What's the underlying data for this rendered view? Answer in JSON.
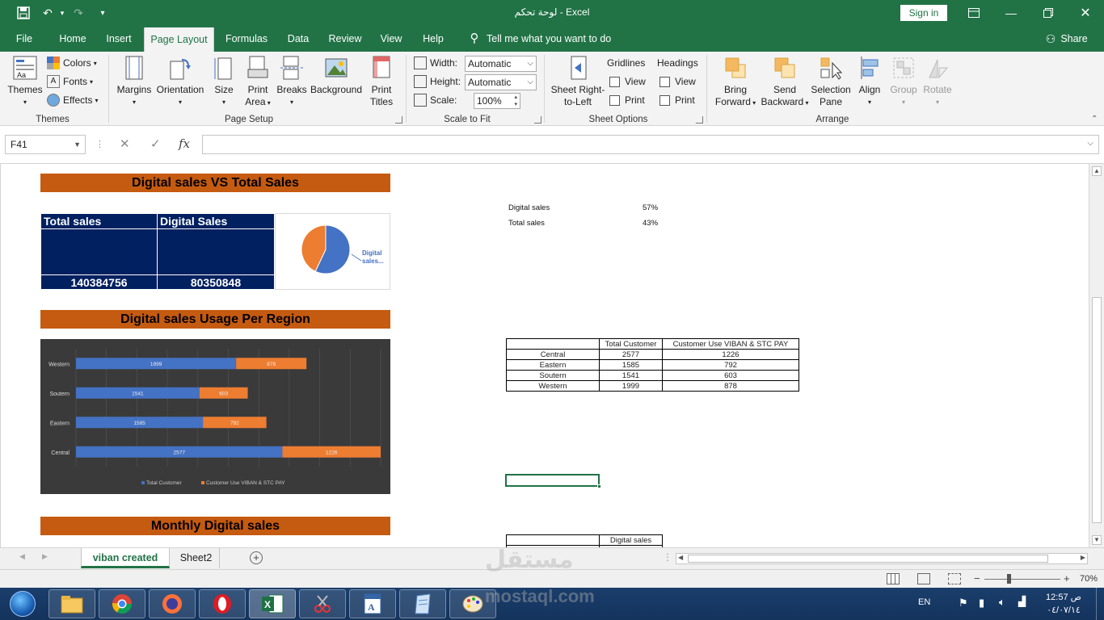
{
  "window": {
    "title": "لوحة تحكم  -  Excel",
    "sign_in": "Sign in",
    "share": "Share"
  },
  "tabs": [
    "File",
    "Home",
    "Insert",
    "Page Layout",
    "Formulas",
    "Data",
    "Review",
    "View",
    "Help"
  ],
  "active_tab": "Page Layout",
  "tell_me": "Tell me what you want to do",
  "ribbon": {
    "themes": {
      "themes_label": "Themes",
      "colors": "Colors",
      "fonts": "Fonts",
      "effects": "Effects",
      "group": "Themes"
    },
    "page_setup": {
      "margins": "Margins",
      "orientation": "Orientation",
      "size": "Size",
      "print_area_1": "Print",
      "print_area_2": "Area",
      "breaks": "Breaks",
      "background": "Background",
      "print_titles_1": "Print",
      "print_titles_2": "Titles",
      "group": "Page Setup"
    },
    "scale_to_fit": {
      "width_label": "Width:",
      "width_value": "Automatic",
      "height_label": "Height:",
      "height_value": "Automatic",
      "scale_label": "Scale:",
      "scale_value": "100%",
      "group": "Scale to Fit"
    },
    "sheet_options": {
      "sheet_rtl_1": "Sheet Right-",
      "sheet_rtl_2": "to-Left",
      "gridlines": "Gridlines",
      "headings": "Headings",
      "view": "View",
      "print": "Print",
      "group": "Sheet Options"
    },
    "arrange": {
      "bring_1": "Bring",
      "bring_2": "Forward",
      "send_1": "Send",
      "send_2": "Backward",
      "selection_1": "Selection",
      "selection_2": "Pane",
      "align": "Align",
      "group_btn": "Group",
      "rotate": "Rotate",
      "group": "Arrange"
    }
  },
  "formula_bar": {
    "name_box": "F41",
    "formula": ""
  },
  "sheet": {
    "banner1": "Digital sales VS Total Sales",
    "banner2": "Digital sales Usage Per Region",
    "banner3": "Monthly Digital sales",
    "kpi": {
      "total_header": "Total sales",
      "digital_header": "Digital Sales",
      "total_value": "140384756",
      "digital_value": "80350848"
    },
    "pie_label_1": "Digital",
    "pie_label_2": "sales...",
    "pct_table": [
      {
        "label": "Digital sales",
        "value": "57%"
      },
      {
        "label": "Total sales",
        "value": "43%"
      }
    ],
    "region_table": {
      "headers": [
        "",
        "Total Customer",
        "Customer Use VIBAN & STC PAY"
      ],
      "rows": [
        [
          "Central",
          "2577",
          "1226"
        ],
        [
          "Eastern",
          "1585",
          "792"
        ],
        [
          "Soutern",
          "1541",
          "603"
        ],
        [
          "Western",
          "1999",
          "878"
        ]
      ]
    },
    "monthly_header": "Digital sales"
  },
  "chart_data": [
    {
      "type": "pie",
      "categories": [
        "Digital sales",
        "Total sales"
      ],
      "values": [
        57,
        43
      ],
      "colors": [
        "#4472c4",
        "#ed7d31"
      ],
      "title": ""
    },
    {
      "type": "bar",
      "orientation": "horizontal",
      "stacked": true,
      "categories": [
        "Western",
        "Soutern",
        "Eastern",
        "Central"
      ],
      "series": [
        {
          "name": "Total Customer",
          "values": [
            1999,
            1541,
            1585,
            2577
          ],
          "color": "#4472c4"
        },
        {
          "name": "Customer Use VIBAN & STC PAY",
          "values": [
            878,
            603,
            792,
            1226
          ],
          "color": "#ed7d31"
        }
      ],
      "legend": "bottom",
      "grid": true
    }
  ],
  "sheet_tabs": [
    "viban created",
    "Sheet2"
  ],
  "active_sheet": "viban created",
  "status": {
    "zoom": "70%"
  },
  "taskbar": {
    "lang": "EN",
    "time": "12:57 ص",
    "date": "٠٤/٠٧/١٤"
  },
  "watermark": {
    "arabic": "مستقل",
    "latin": "mostaql.com"
  }
}
